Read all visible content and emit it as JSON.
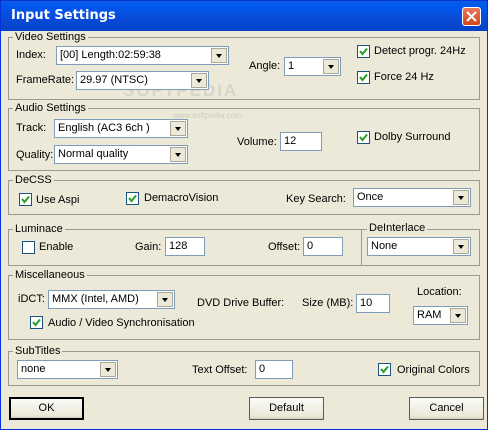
{
  "window": {
    "title": "Input Settings"
  },
  "watermark": {
    "text": "SOFTPEDIA",
    "url": "www.softpedia.com"
  },
  "video": {
    "legend": "Video Settings",
    "index_label": "Index:",
    "index_value": "[00] Length:02:59:38",
    "framerate_label": "FrameRate:",
    "framerate_value": "29.97 (NTSC)",
    "angle_label": "Angle:",
    "angle_value": "1",
    "detect_label": "Detect progr. 24Hz",
    "detect_checked": true,
    "force_label": "Force 24 Hz",
    "force_checked": true
  },
  "audio": {
    "legend": "Audio Settings",
    "track_label": "Track:",
    "track_value": "English (AC3 6ch )",
    "quality_label": "Quality:",
    "quality_value": "Normal quality",
    "volume_label": "Volume:",
    "volume_value": "12",
    "dolby_label": "Dolby Surround",
    "dolby_checked": true
  },
  "decss": {
    "legend": "DeCSS",
    "aspi_label": "Use Aspi",
    "aspi_checked": true,
    "demacro_label": "DemacroVision",
    "demacro_checked": true,
    "keysearch_label": "Key Search:",
    "keysearch_value": "Once"
  },
  "luminance": {
    "legend": "Luminace",
    "enable_label": "Enable",
    "enable_checked": false,
    "gain_label": "Gain:",
    "gain_value": "128",
    "offset_label": "Offset:",
    "offset_value": "0"
  },
  "deinterlace": {
    "legend": "DeInterlace",
    "value": "None"
  },
  "misc": {
    "legend": "Miscellaneous",
    "idct_label": "iDCT:",
    "idct_value": "MMX (Intel, AMD)",
    "buffer_label": "DVD Drive Buffer:",
    "size_label": "Size (MB):",
    "size_value": "10",
    "location_label": "Location:",
    "location_value": "RAM",
    "sync_label": "Audio / Video Synchronisation",
    "sync_checked": true
  },
  "subtitles": {
    "legend": "SubTitles",
    "value": "none",
    "text_offset_label": "Text Offset:",
    "text_offset_value": "0",
    "original_colors_label": "Original Colors",
    "original_colors_checked": true
  },
  "buttons": {
    "ok": "OK",
    "default": "Default",
    "cancel": "Cancel"
  }
}
